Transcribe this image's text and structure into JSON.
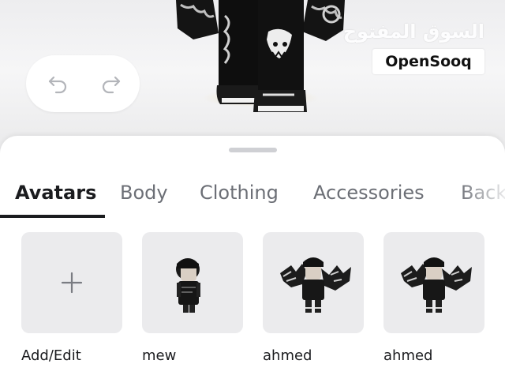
{
  "watermark": {
    "arabic": "السوق المفتوح",
    "brand": "OpenSooq"
  },
  "toolbar": {
    "undo_icon": "undo-arrow-icon",
    "redo_icon": "redo-arrow-icon"
  },
  "tabs": [
    {
      "label": "Avatars",
      "active": true
    },
    {
      "label": "Body",
      "active": false
    },
    {
      "label": "Clothing",
      "active": false
    },
    {
      "label": "Accessories",
      "active": false
    },
    {
      "label": "Back",
      "active": false
    }
  ],
  "avatars": [
    {
      "label": "Add/Edit",
      "icon": "plus-icon"
    },
    {
      "label": "mew"
    },
    {
      "label": "ahmed"
    },
    {
      "label": "ahmed"
    }
  ],
  "colors": {
    "sheet_bg": "#ffffff",
    "card_bg": "#ebebed",
    "active_tab": "#1b1c1f",
    "inactive_tab": "#6c6f76",
    "handle": "#cfd0d4"
  }
}
